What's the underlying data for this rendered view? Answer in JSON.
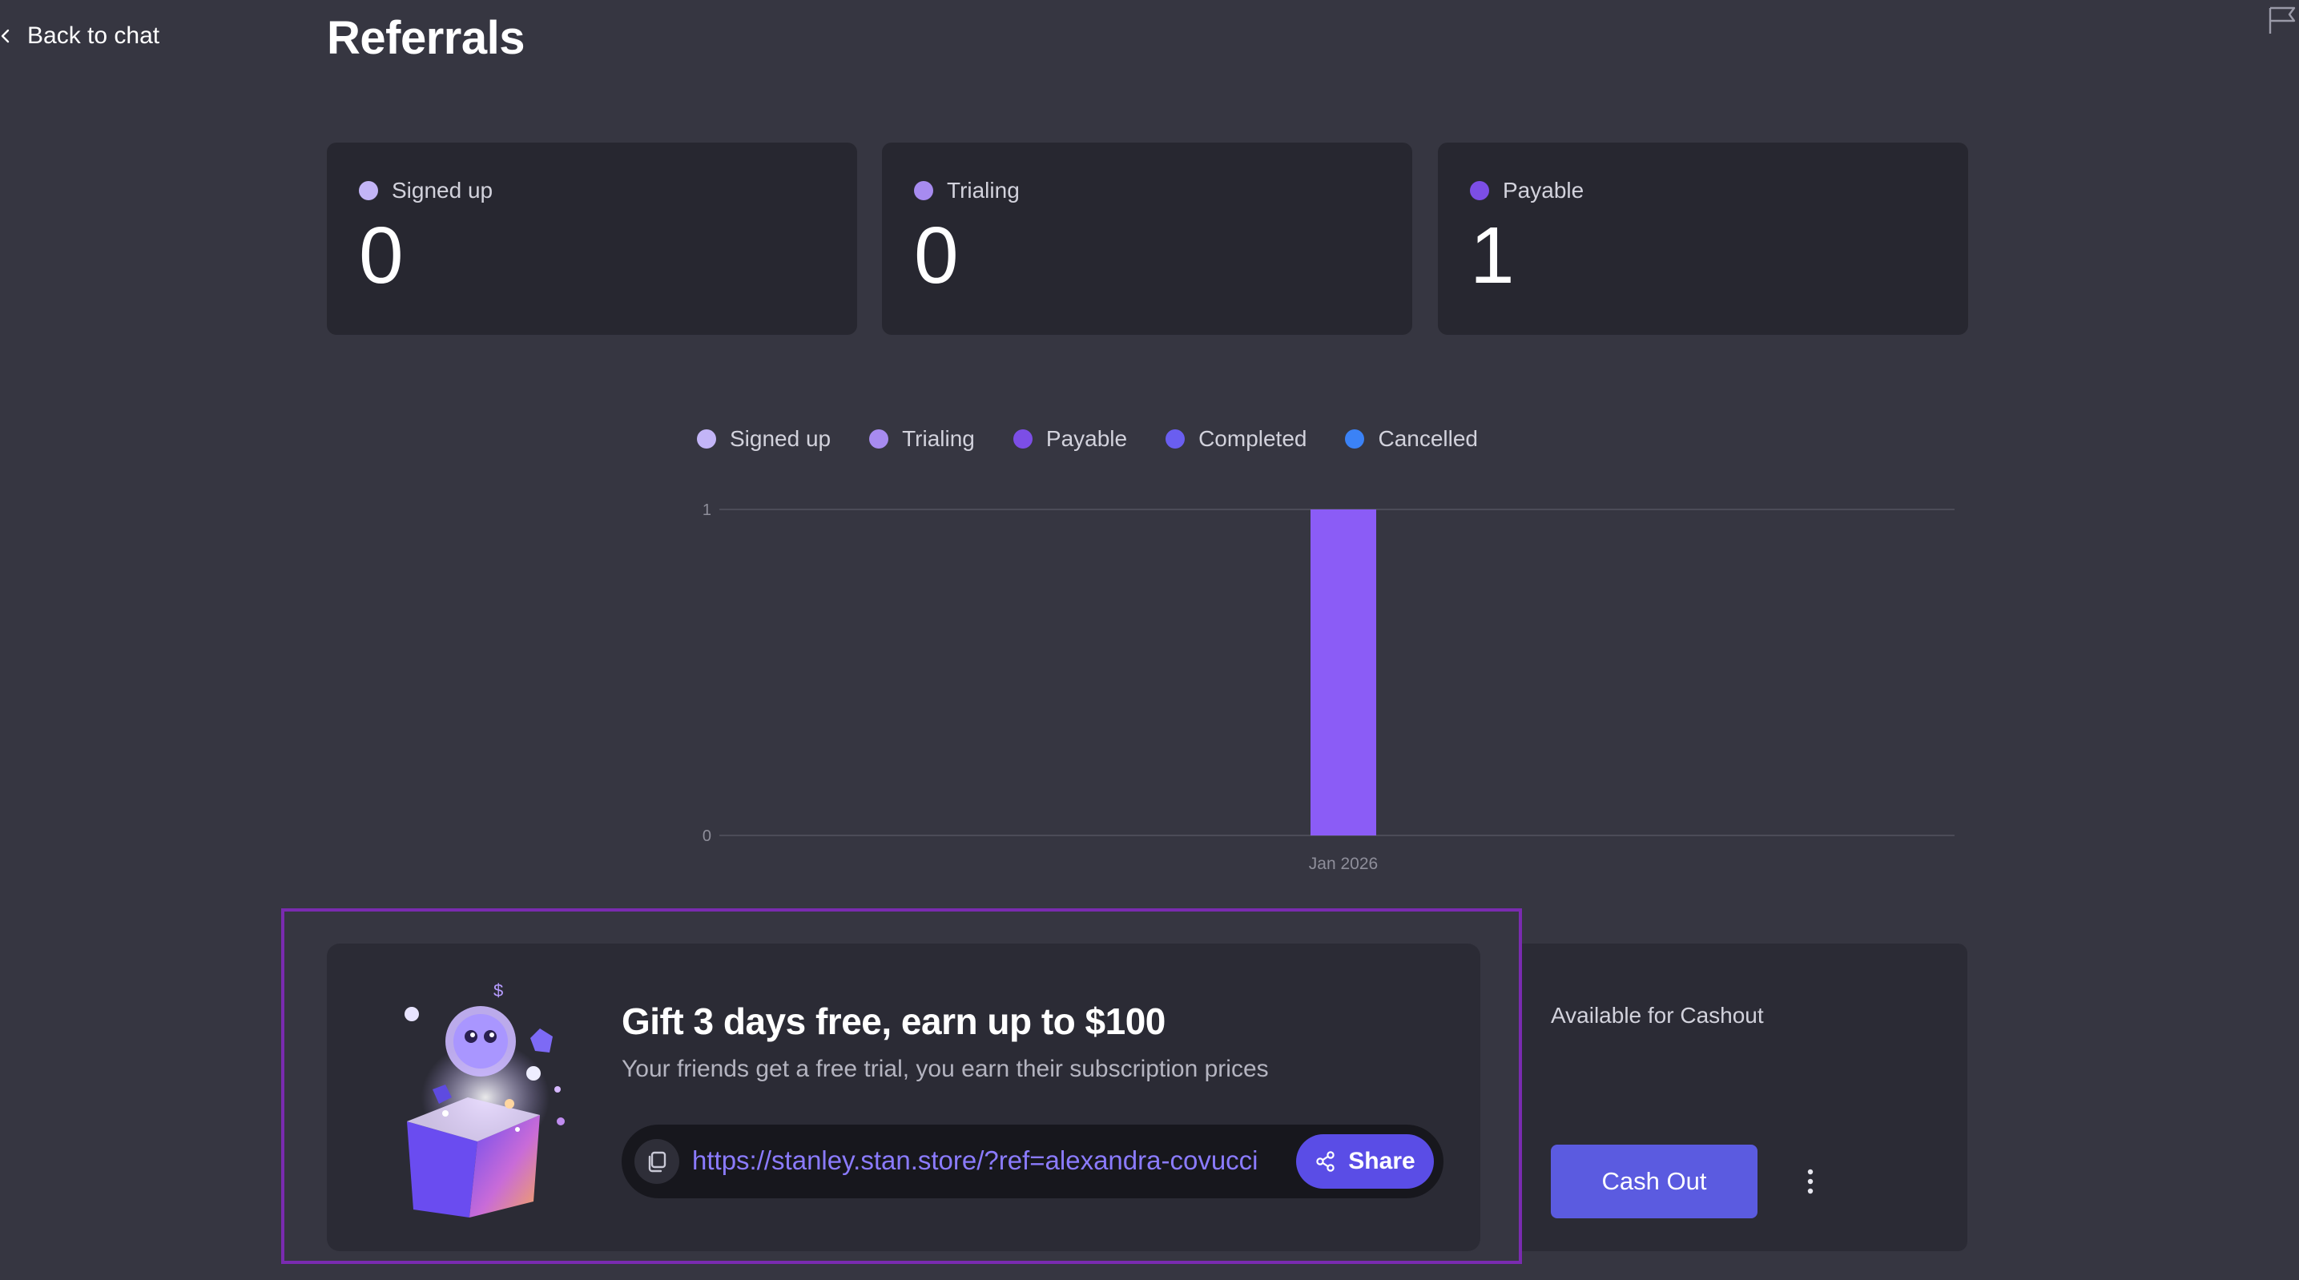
{
  "nav": {
    "back_label": "Back to chat"
  },
  "page": {
    "title": "Referrals"
  },
  "icons": {
    "back": "chevron-left-icon",
    "flag": "flag-icon",
    "copy": "copy-icon",
    "share": "share-icon",
    "more": "more-vertical-icon"
  },
  "stats": [
    {
      "label": "Signed up",
      "value": "0",
      "color": "#c3b5f7"
    },
    {
      "label": "Trialing",
      "value": "0",
      "color": "#a78bf0"
    },
    {
      "label": "Payable",
      "value": "1",
      "color": "#7c4ee6"
    }
  ],
  "legend": [
    {
      "label": "Signed up",
      "color": "#c3b5f7"
    },
    {
      "label": "Trialing",
      "color": "#a78bf0"
    },
    {
      "label": "Payable",
      "color": "#7c4ee6"
    },
    {
      "label": "Completed",
      "color": "#6a5ef0"
    },
    {
      "label": "Cancelled",
      "color": "#3b82f6"
    }
  ],
  "chart_data": {
    "type": "bar",
    "categories": [
      "Jan 2026"
    ],
    "series": [
      {
        "name": "Payable",
        "values": [
          1
        ],
        "color": "#8b5cf6"
      }
    ],
    "title": "",
    "xlabel": "",
    "ylabel": "",
    "ylim": [
      0,
      1
    ],
    "yticks": [
      "0",
      "1"
    ],
    "grid": true,
    "legend_position": "top"
  },
  "promo": {
    "title": "Gift 3 days free, earn up to $100",
    "subtitle": "Your friends get a free trial, you earn their subscription prices",
    "referral_link": "https://stanley.stan.store/?ref=alexandra-covucci",
    "share_label": "Share"
  },
  "cashout": {
    "label": "Available for Cashout",
    "button_label": "Cash Out"
  },
  "colors": {
    "accent": "#5b5be0",
    "link": "#8b7bff",
    "highlight": "#7a2bb0"
  }
}
